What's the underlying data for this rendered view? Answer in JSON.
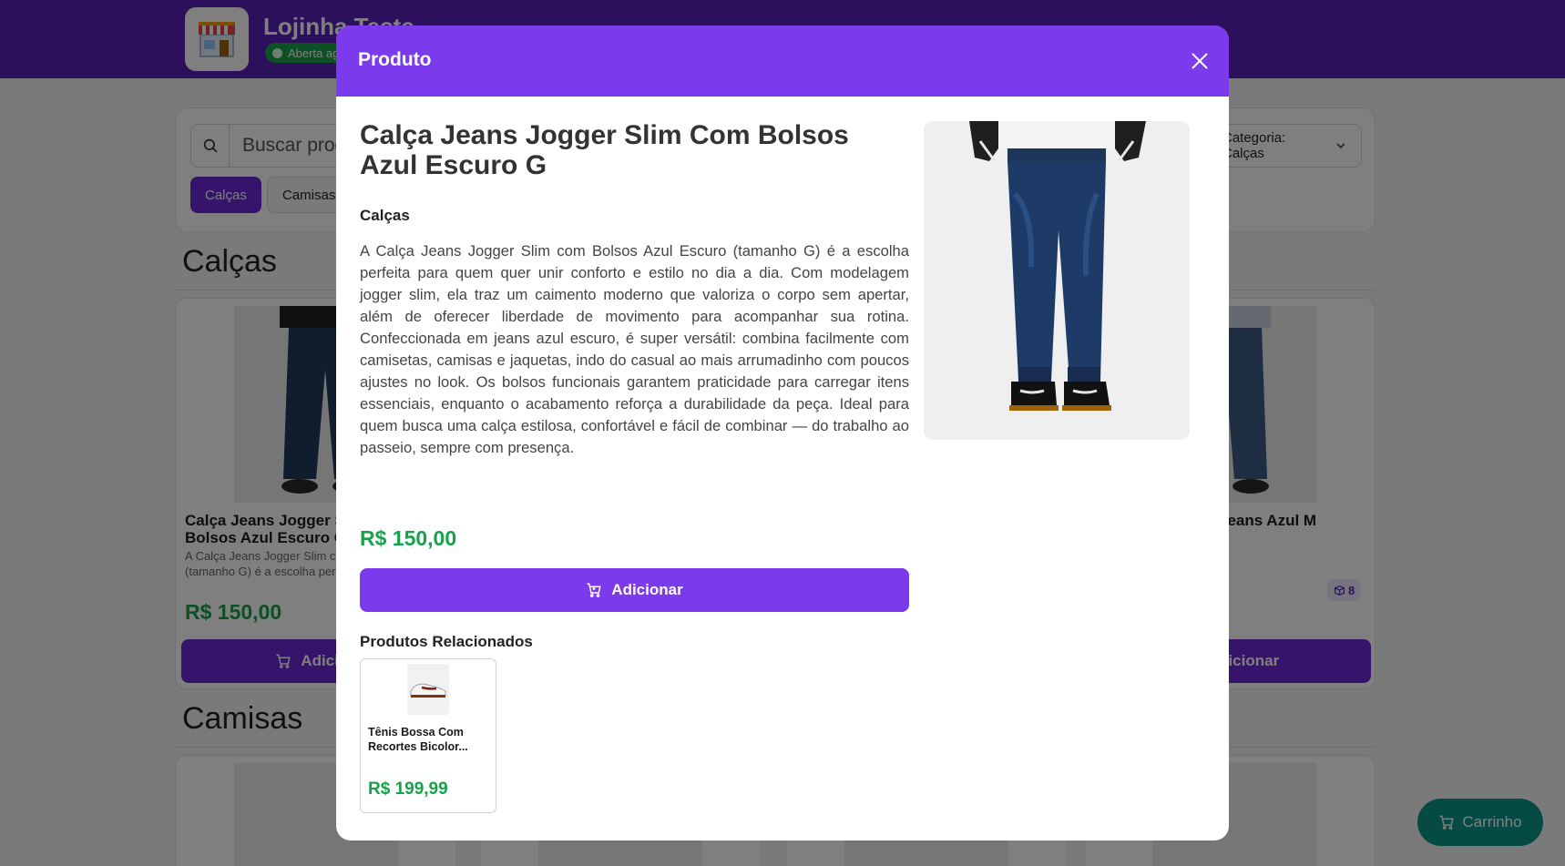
{
  "store": {
    "name": "Lojinha Teste",
    "status": "Aberta agora"
  },
  "search": {
    "placeholder": "Buscar produtos...",
    "category_select": "Categoria: Calças"
  },
  "chips": [
    "Calças",
    "Camisas"
  ],
  "sections": {
    "pants": "Calças",
    "shirts": "Camisas"
  },
  "bg_cards": {
    "first": {
      "title": "Calça Jeans Jogger Slim Com Bolsos Azul Escuro G",
      "desc": "A Calça Jeans Jogger Slim com Bolsos Azul Escuro (tamanho G) é a escolha perfeita",
      "price": "R$ 150,00",
      "button": "Adicionar"
    },
    "last": {
      "title": "Calça Masculina Jeans Azul M",
      "stock": "8",
      "button": "Adicionar"
    }
  },
  "cart_button": "Carrinho",
  "modal": {
    "header": "Produto",
    "product": {
      "name": "Calça Jeans Jogger Slim Com Bolsos Azul Escuro G",
      "category": "Calças",
      "description": "A Calça Jeans Jogger Slim com Bolsos Azul Escuro (tamanho G) é a escolha perfeita para quem quer unir conforto e estilo no dia a dia. Com modelagem jogger slim, ela traz um caimento moderno que valoriza o corpo sem apertar, além de oferecer liberdade de movimento para acompanhar sua rotina. Confeccionada em jeans azul escuro, é super versátil: combina facilmente com camisetas, camisas e jaquetas, indo do casual ao mais arrumadinho com poucos ajustes no look. Os bolsos funcionais garantem praticidade para carregar itens essenciais, enquanto o acabamento reforça a durabilidade da peça.  Ideal para quem busca uma calça estilosa, confortável e fácil de combinar — do trabalho ao passeio, sempre com presença.",
      "price": "R$ 150,00",
      "add_button": "Adicionar"
    },
    "related_title": "Produtos Relacionados",
    "related": [
      {
        "name": "Tênis Bossa Com Recortes Bicolor...",
        "price": "R$ 199,99"
      }
    ]
  },
  "colors": {
    "brand": "#5b21b6",
    "accent": "#7c3aed",
    "price": "#16a34a",
    "cart": "#0d9488"
  }
}
